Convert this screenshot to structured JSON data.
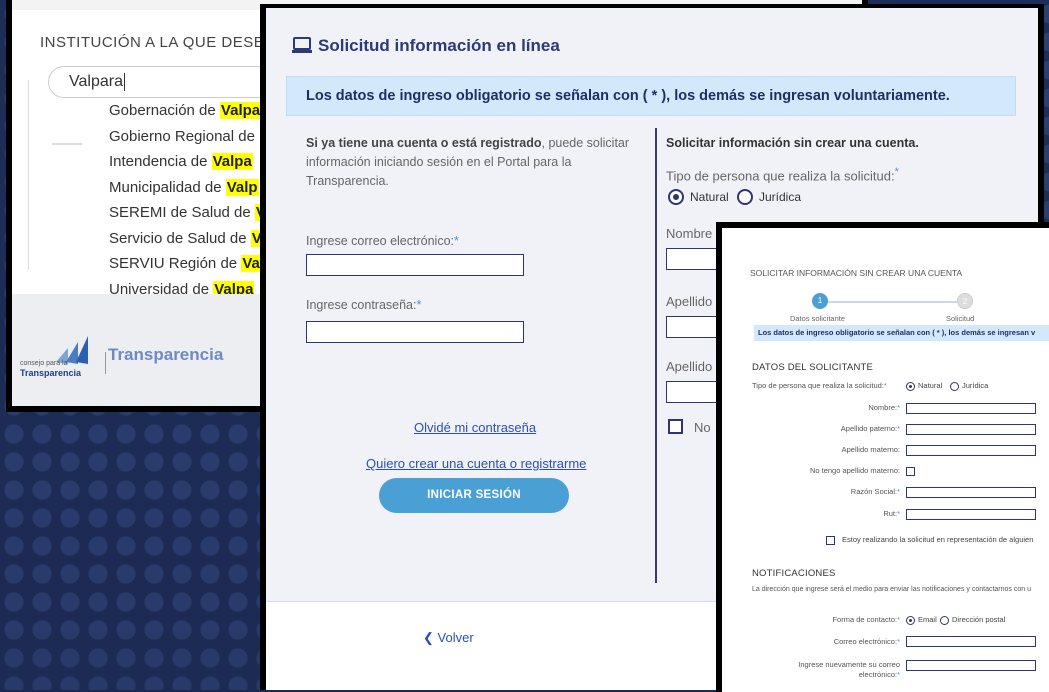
{
  "panel1": {
    "institution_label": "INSTITUCIÓN A LA QUE DESE",
    "search_value": "Valpara",
    "dropdown_items": [
      {
        "before": "Gobernación de ",
        "match": "Valpa"
      },
      {
        "before": "Gobierno Regional de",
        "match": ""
      },
      {
        "before": "Intendencia de ",
        "match": "Valpa"
      },
      {
        "before": "Municipalidad de ",
        "match": "Valp"
      },
      {
        "before": "SEREMI de Salud de ",
        "match": "V"
      },
      {
        "before": "Servicio de Salud de ",
        "match": "V"
      },
      {
        "before": "SERVIU Región de ",
        "match": "Va"
      },
      {
        "before": "Universidad de ",
        "match": "Valpa"
      }
    ],
    "logo_small": "consejo para la",
    "logo_brand": "Transparencia",
    "logo_text": "Transparencia"
  },
  "panel2": {
    "title": "Solicitud información en línea",
    "infobar": "Los datos de ingreso obligatorio se señalan con ( * ), los demás se ingresan voluntariamente.",
    "left_intro_bold": "Si ya tiene una cuenta o está registrado",
    "left_intro_rest": ", puede solicitar información iniciando sesión en el Portal para la Transparencia.",
    "email_label": "Ingrese correo electrónico:",
    "password_label": "Ingrese contraseña:",
    "required_mark": "*",
    "forgot_link": "Olvidé mi contraseña",
    "register_link": "Quiero crear una cuenta o registrarme",
    "login_button": "INICIAR SESIÓN",
    "right_title": "Solicitar información sin crear una cuenta.",
    "person_type_label": "Tipo de persona que realiza la solicitud:",
    "radio_natural": "Natural",
    "radio_juridica": "Jurídica",
    "nombre_label": "Nombre",
    "apellido1_label": "Apellido",
    "apellido2_label": "Apellido",
    "no_label": "No",
    "back_link": "Volver",
    "back_icon": "chevron-left-icon"
  },
  "panel3": {
    "header": "SOLICITAR INFORMACIÓN SIN CREAR UNA CUENTA",
    "step1_num": "1",
    "step1_label": "Datos solicitante",
    "step2_num": "2",
    "step2_label": "Solicitud",
    "infobar": "Los datos de ingreso obligatorio se señalan con ( * ), los demás se ingresan v",
    "section_solicitante": "DATOS DEL SOLICITANTE",
    "person_type_label": "Tipo de persona que realiza la solicitud:",
    "radio_natural": "Natural",
    "radio_juridica": "Jurídica",
    "fields": [
      {
        "label": "Nombre:",
        "req": "*"
      },
      {
        "label": "Apellido paterno:",
        "req": "*"
      },
      {
        "label": "Apellido materno:",
        "req": ""
      },
      {
        "label": "No tengo apellido materno:",
        "req": "",
        "checkbox": true
      },
      {
        "label": "Razón Social:",
        "req": "*"
      },
      {
        "label": "Rut:",
        "req": "*"
      }
    ],
    "representation_check": "Estoy realizando la solicitud en representación de alguien",
    "section_notif": "NOTIFICACIONES",
    "notif_desc": "La dirección que ingrese será el medio para enviar las notificaciones y contactarnos con u",
    "contact_label": "Forma de contacto:",
    "radio_email": "Email",
    "radio_postal": "Dirección postal",
    "email_label": "Correo electrónico:",
    "email2_label_1": "Ingrese nuevamente su correo",
    "email2_label_2": "electrónico:"
  },
  "colors": {
    "navy": "#2f3570",
    "accent_blue": "#4a9fd4",
    "info_bg": "#d4e8fb",
    "highlight": "#ffff00",
    "link": "#2d4fb5"
  }
}
